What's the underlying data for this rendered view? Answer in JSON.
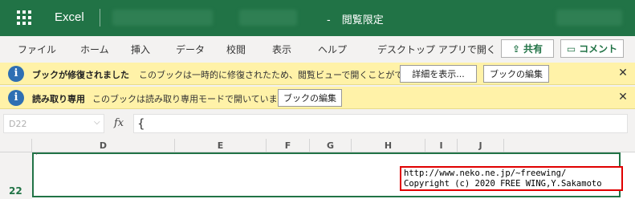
{
  "app": {
    "name": "Excel",
    "document_title": "-",
    "mode": "閲覧限定"
  },
  "menu": {
    "items": [
      "ファイル",
      "ホーム",
      "挿入",
      "データ",
      "校閲",
      "表示",
      "ヘルプ",
      "デスクトップ アプリで開く"
    ],
    "share_label": "共有",
    "comment_label": "コメント"
  },
  "infobars": [
    {
      "title": "ブックが修復されました",
      "message": "このブックは一時的に修復されたため、閲覧ビューで開くことができます。",
      "buttons": [
        "詳細を表示...",
        "ブックの編集"
      ],
      "close": "✕"
    },
    {
      "title": "読み取り専用",
      "message": "このブックは読み取り専用モードで開いています",
      "buttons": [
        "ブックの編集"
      ],
      "close": "✕"
    }
  ],
  "formula_bar": {
    "name_box": "D22",
    "fx_label": "fx",
    "formula": "{"
  },
  "grid": {
    "columns": [
      "D",
      "E",
      "F",
      "G",
      "H",
      "I",
      "J"
    ],
    "row": "22",
    "cell_mark": "'"
  },
  "watermark": {
    "line1": "http://www.neko.ne.jp/~freewing/",
    "line2": "Copyright (c) 2020 FREE WING,Y.Sakamoto"
  },
  "colors": {
    "brand": "#217346",
    "infobar": "#fff2a8",
    "info_icon": "#2e6fb3",
    "watermark_border": "#e00000"
  }
}
